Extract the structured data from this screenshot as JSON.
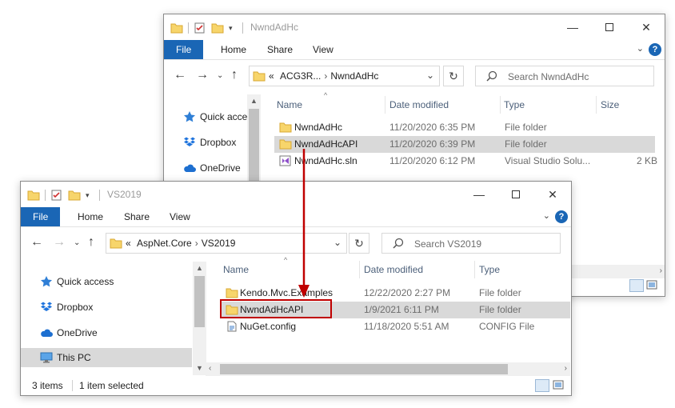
{
  "back_window": {
    "title": "NwndAdHc",
    "tabs": [
      "File",
      "Home",
      "Share",
      "View"
    ],
    "breadcrumb": {
      "prefix": "«",
      "items": [
        "ACG3R...",
        "NwndAdHc"
      ]
    },
    "search_placeholder": "Search NwndAdHc",
    "nav_items": [
      {
        "label": "Quick access",
        "icon": "star-icon"
      },
      {
        "label": "Dropbox",
        "icon": "dropbox-icon"
      },
      {
        "label": "OneDrive",
        "icon": "cloud-icon"
      }
    ],
    "columns": [
      "Name",
      "Date modified",
      "Type",
      "Size"
    ],
    "rows": [
      {
        "name": "NwndAdHc",
        "date": "11/20/2020 6:35 PM",
        "type": "File folder",
        "size": "",
        "icon": "folder-icon"
      },
      {
        "name": "NwndAdHcAPI",
        "date": "11/20/2020 6:39 PM",
        "type": "File folder",
        "size": "",
        "icon": "folder-icon",
        "selected": true
      },
      {
        "name": "NwndAdHc.sln",
        "date": "11/20/2020 6:12 PM",
        "type": "Visual Studio Solu...",
        "size": "2 KB",
        "icon": "vs-solution-icon"
      }
    ]
  },
  "front_window": {
    "title": "VS2019",
    "tabs": [
      "File",
      "Home",
      "Share",
      "View"
    ],
    "breadcrumb": {
      "prefix": "«",
      "items": [
        "AspNet.Core",
        "VS2019"
      ]
    },
    "search_placeholder": "Search VS2019",
    "nav_items": [
      {
        "label": "Quick access",
        "icon": "star-icon"
      },
      {
        "label": "Dropbox",
        "icon": "dropbox-icon"
      },
      {
        "label": "OneDrive",
        "icon": "cloud-icon"
      },
      {
        "label": "This PC",
        "icon": "monitor-icon",
        "selected": true
      }
    ],
    "columns": [
      "Name",
      "Date modified",
      "Type"
    ],
    "rows": [
      {
        "name": "Kendo.Mvc.Examples",
        "date": "12/22/2020 2:27 PM",
        "type": "File folder",
        "icon": "folder-icon"
      },
      {
        "name": "NwndAdHcAPI",
        "date": "1/9/2021 6:11 PM",
        "type": "File folder",
        "icon": "folder-icon",
        "selected": true
      },
      {
        "name": "NuGet.config",
        "date": "11/18/2020 5:51 AM",
        "type": "CONFIG File",
        "icon": "config-file-icon"
      }
    ],
    "status": {
      "items_count": "3 items",
      "selected_count": "1 item selected"
    }
  },
  "colors": {
    "accent": "#1a66b5",
    "highlight": "#c00000",
    "selection": "#d9d9d9"
  }
}
